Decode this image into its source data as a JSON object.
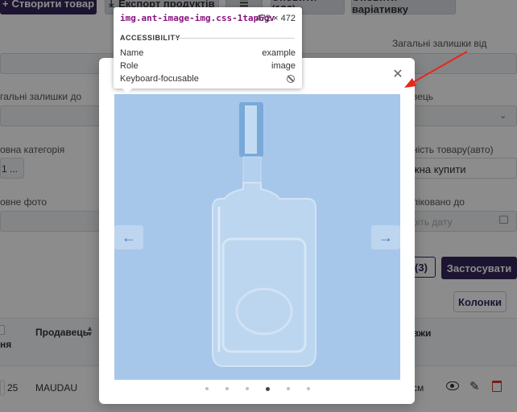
{
  "toolbar": {
    "create_product": "Створити товар",
    "export_products": "Експорт продуктів",
    "update_count": "Оновити (136)",
    "update_variations": "Оновити варіативку"
  },
  "filters": {
    "total_stock_from_label": "Загальні залишки від",
    "total_stock_to_label": "гальні залишки до",
    "level_label": "вець",
    "main_category_label": "овна категорія",
    "main_category_value": "1 ...",
    "availability_label": "ність товару(авто)",
    "availability_value": "жна купити",
    "main_photo_label": "овне фото",
    "published_to_label": "ліковано до",
    "published_to_placeholder": "ріть дату",
    "selected_count": "(3)",
    "apply": "Застосувати",
    "columns": "Колонки"
  },
  "table": {
    "header_col_left": "ня",
    "header_seller": "Продавець",
    "header_right": "овжи\nи",
    "row1": {
      "qty": "25",
      "seller": "MAUDAU",
      "right": "см"
    }
  },
  "tooltip": {
    "selector": "img.ant-image-img.css-1tap6gv",
    "size": "472 × 472",
    "section": "ACCESSIBILITY",
    "name_key": "Name",
    "name_value": "example",
    "role_key": "Role",
    "role_value": "image",
    "focusable_key": "Keyboard-focusable"
  },
  "modal": {
    "close_icon": "close-icon",
    "prev_icon": "arrow-left-icon",
    "next_icon": "arrow-right-icon",
    "slides": 6,
    "active_slide": 4
  },
  "colors": {
    "primary": "#33255a",
    "image_highlight": "#a7c7ea",
    "annotation_arrow": "#e8271b"
  }
}
